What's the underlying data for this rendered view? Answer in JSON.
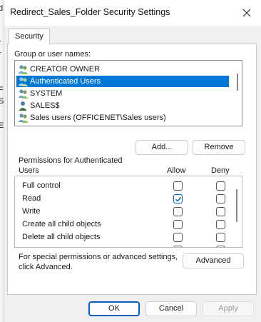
{
  "window": {
    "title": "Redirect_Sales_Folder Security Settings",
    "close_icon": "close-icon"
  },
  "tabs": [
    {
      "label": "Security",
      "active": true
    }
  ],
  "groups": {
    "label": "Group or user names:",
    "items": [
      {
        "name": "CREATOR OWNER",
        "icon": "users-icon",
        "selected": false
      },
      {
        "name": "Authenticated Users",
        "icon": "users-icon",
        "selected": true
      },
      {
        "name": "SYSTEM",
        "icon": "users-icon",
        "selected": false
      },
      {
        "name": "SALES$",
        "icon": "user-icon",
        "selected": false
      },
      {
        "name": "Sales  users (OFFICENET\\Sales  users)",
        "icon": "users-icon",
        "selected": false
      }
    ],
    "add_label": "Add...",
    "remove_label": "Remove"
  },
  "permissions": {
    "header_line1": "Permissions for Authenticated",
    "header_line2": "Users",
    "allow_label": "Allow",
    "deny_label": "Deny",
    "rows": [
      {
        "name": "Full control",
        "allow": false,
        "deny": false
      },
      {
        "name": "Read",
        "allow": true,
        "deny": false
      },
      {
        "name": "Write",
        "allow": false,
        "deny": false
      },
      {
        "name": "Create all child objects",
        "allow": false,
        "deny": false
      },
      {
        "name": "Delete all child objects",
        "allow": false,
        "deny": false
      }
    ]
  },
  "special": {
    "line1": "For special permissions or advanced settings,",
    "line2": "click Advanced.",
    "advanced_label": "Advanced"
  },
  "footer": {
    "ok_label": "OK",
    "cancel_label": "Cancel",
    "apply_label": "Apply",
    "apply_enabled": false
  },
  "colors": {
    "selection": "#0078d7",
    "accent": "#005fb8",
    "dialog_bg": "#f0f0f0"
  },
  "background_window": {
    "edge_chars": [
      "d",
      "r",
      "r",
      "F",
      "S",
      "E"
    ]
  }
}
